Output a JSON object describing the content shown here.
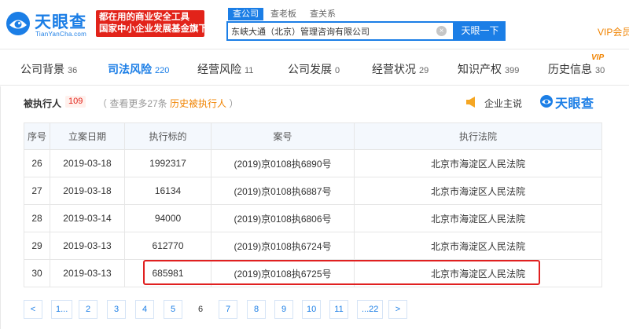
{
  "header": {
    "logo_cn": "天眼查",
    "logo_en": "TianYanCha.com",
    "slogan_line1": "都在用的商业安全工具",
    "slogan_line2": "国家中小企业发展基金旗下",
    "search_tabs": [
      "查公司",
      "查老板",
      "查关系"
    ],
    "search_value": "东峡大通（北京）管理咨询有限公司",
    "search_button": "天眼一下",
    "vip_link": "VIP会员"
  },
  "nav": {
    "items": [
      {
        "label": "公司背景",
        "count": "36"
      },
      {
        "label": "司法风险",
        "count": "220"
      },
      {
        "label": "经营风险",
        "count": "11"
      },
      {
        "label": "公司发展",
        "count": "0"
      },
      {
        "label": "经营状况",
        "count": "29"
      },
      {
        "label": "知识产权",
        "count": "399"
      },
      {
        "label": "历史信息",
        "count": "30"
      }
    ],
    "active_index": 1,
    "vip_badge": "VIP"
  },
  "section": {
    "title": "被执行人",
    "count": "109",
    "more_prefix": "（ 查看更多27条",
    "more_link": "历史被执行人",
    "more_suffix": " ）",
    "owner_say": "企业主说",
    "brand": "天眼查"
  },
  "table": {
    "headers": [
      "序号",
      "立案日期",
      "执行标的",
      "案号",
      "执行法院"
    ],
    "rows": [
      [
        "26",
        "2019-03-18",
        "1992317",
        "(2019)京0108执6890号",
        "北京市海淀区人民法院"
      ],
      [
        "27",
        "2019-03-18",
        "16134",
        "(2019)京0108执6887号",
        "北京市海淀区人民法院"
      ],
      [
        "28",
        "2019-03-14",
        "94000",
        "(2019)京0108执6806号",
        "北京市海淀区人民法院"
      ],
      [
        "29",
        "2019-03-13",
        "612770",
        "(2019)京0108执6724号",
        "北京市海淀区人民法院"
      ],
      [
        "30",
        "2019-03-13",
        "685981",
        "(2019)京0108执6725号",
        "北京市海淀区人民法院"
      ]
    ]
  },
  "pager": {
    "items": [
      "<",
      "1...",
      "2",
      "3",
      "4",
      "5",
      "6",
      "7",
      "8",
      "9",
      "10",
      "11",
      "...22",
      ">"
    ],
    "current": "6"
  },
  "colors": {
    "brand_blue": "#1b7ee6",
    "accent_orange": "#f08300",
    "alert_red": "#e2231a"
  }
}
